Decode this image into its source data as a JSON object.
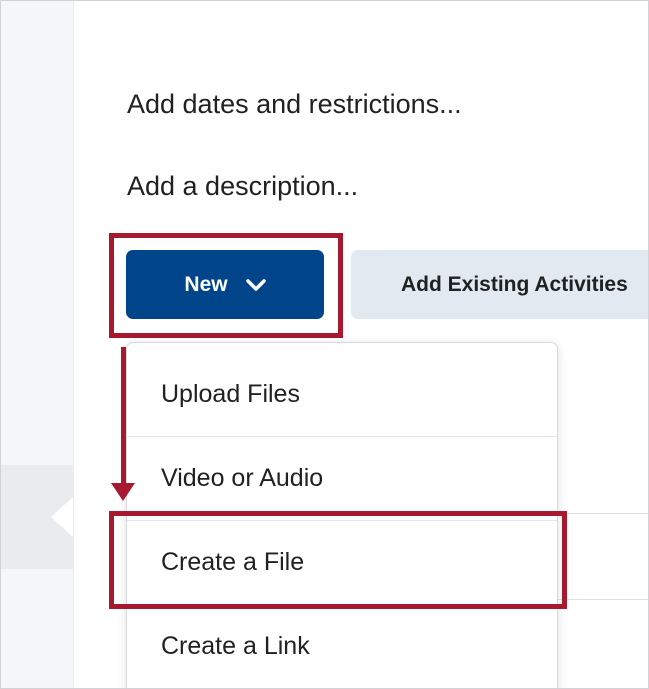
{
  "content": {
    "dates_link": "Add dates and restrictions...",
    "description_link": "Add a description..."
  },
  "toolbar": {
    "new_button_label": "New",
    "add_existing_label": "Add Existing Activities"
  },
  "new_menu": {
    "items": [
      {
        "label": "Upload Files"
      },
      {
        "label": "Video or Audio"
      },
      {
        "label": "Create a File"
      },
      {
        "label": "Create a Link"
      }
    ]
  },
  "colors": {
    "primary_button": "#004489",
    "secondary_button": "#e3e9f1",
    "annotation": "#a6192e"
  },
  "icons": {
    "new_button_icon": "chevron-down-icon"
  }
}
